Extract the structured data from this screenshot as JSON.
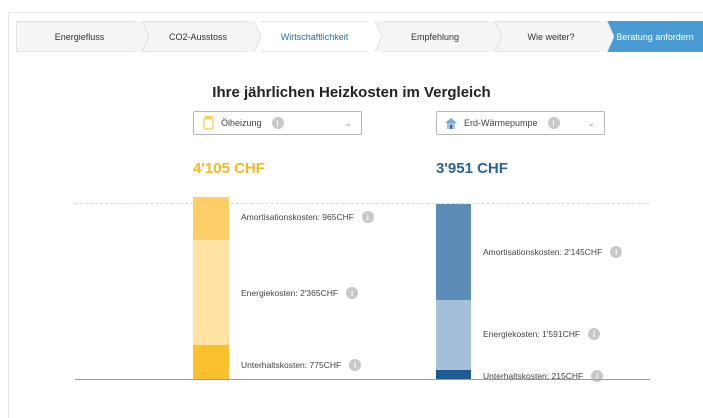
{
  "steps": [
    {
      "label": "Energiefluss"
    },
    {
      "label": "CO2-Ausstoss"
    },
    {
      "label": "Wirtschaftlichkeit"
    },
    {
      "label": "Empfehlung"
    },
    {
      "label": "Wie weiter?"
    },
    {
      "label": "Beratung anfordern"
    }
  ],
  "heading": "Ihre jährlichen Heizkosten im Vergleich",
  "left": {
    "select_label": "Ölheizung",
    "total": "4'105 CHF",
    "color": "#f5b82a",
    "segments": [
      {
        "label": "Amortisationskosten: 965CHF",
        "color": "#fbce68"
      },
      {
        "label": "Energiekosten: 2'365CHF",
        "color": "#fee3a2"
      },
      {
        "label": "Unterhaltskosten: 775CHF",
        "color": "#fbc02d"
      }
    ]
  },
  "right": {
    "select_label": "Erd-Wärmepumpe",
    "total": "3'951 CHF",
    "color": "#2e6493",
    "segments": [
      {
        "label": "Amortisationskosten: 2'145CHF",
        "color": "#5b8db8"
      },
      {
        "label": "Energiekosten: 1'591CHF",
        "color": "#a4bfd8"
      },
      {
        "label": "Unterhaltskosten: 215CHF",
        "color": "#1f5a92"
      }
    ]
  }
}
